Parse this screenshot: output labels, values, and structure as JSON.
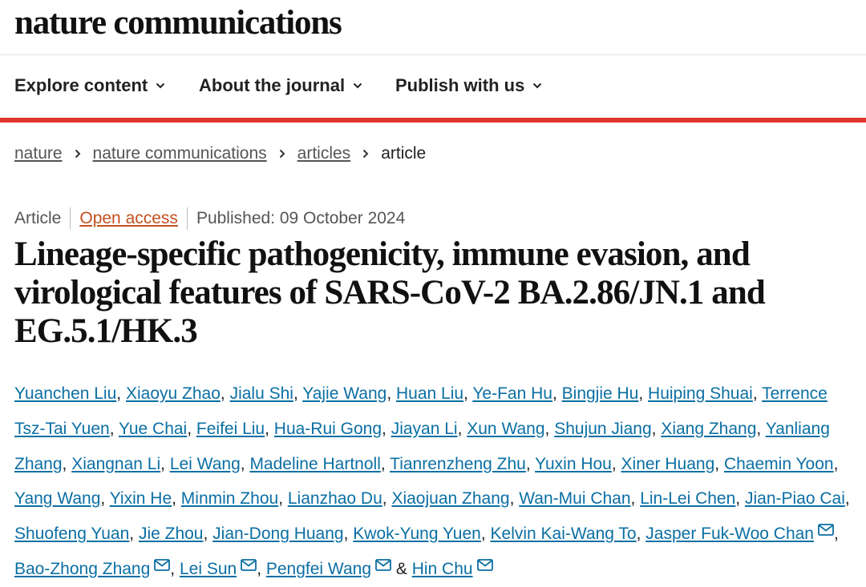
{
  "journal": {
    "name": "nature communications"
  },
  "nav": {
    "items": [
      {
        "label": "Explore content"
      },
      {
        "label": "About the journal"
      },
      {
        "label": "Publish with us"
      }
    ]
  },
  "breadcrumb": {
    "items": [
      "nature",
      "nature communications",
      "articles"
    ],
    "current": "article"
  },
  "article": {
    "type": "Article",
    "access": "Open access",
    "published": "Published: 09 October 2024",
    "title": "Lineage-specific pathogenicity, immune evasion, and virological features of SARS-CoV-2 BA.2.86/JN.1 and EG.5.1/HK.3",
    "authors": [
      {
        "name": "Yuanchen Liu",
        "email": false
      },
      {
        "name": "Xiaoyu Zhao",
        "email": false
      },
      {
        "name": "Jialu Shi",
        "email": false
      },
      {
        "name": "Yajie Wang",
        "email": false
      },
      {
        "name": "Huan Liu",
        "email": false
      },
      {
        "name": "Ye-Fan Hu",
        "email": false
      },
      {
        "name": "Bingjie Hu",
        "email": false
      },
      {
        "name": "Huiping Shuai",
        "email": false
      },
      {
        "name": "Terrence Tsz-Tai Yuen",
        "email": false
      },
      {
        "name": "Yue Chai",
        "email": false
      },
      {
        "name": "Feifei Liu",
        "email": false
      },
      {
        "name": "Hua-Rui Gong",
        "email": false
      },
      {
        "name": "Jiayan Li",
        "email": false
      },
      {
        "name": "Xun Wang",
        "email": false
      },
      {
        "name": "Shujun Jiang",
        "email": false
      },
      {
        "name": "Xiang Zhang",
        "email": false
      },
      {
        "name": "Yanliang Zhang",
        "email": false
      },
      {
        "name": "Xiangnan Li",
        "email": false
      },
      {
        "name": "Lei Wang",
        "email": false
      },
      {
        "name": "Madeline Hartnoll",
        "email": false
      },
      {
        "name": "Tianrenzheng Zhu",
        "email": false
      },
      {
        "name": "Yuxin Hou",
        "email": false
      },
      {
        "name": "Xiner Huang",
        "email": false
      },
      {
        "name": "Chaemin Yoon",
        "email": false
      },
      {
        "name": "Yang Wang",
        "email": false
      },
      {
        "name": "Yixin He",
        "email": false
      },
      {
        "name": "Minmin Zhou",
        "email": false
      },
      {
        "name": "Lianzhao Du",
        "email": false
      },
      {
        "name": "Xiaojuan Zhang",
        "email": false
      },
      {
        "name": "Wan-Mui Chan",
        "email": false
      },
      {
        "name": "Lin-Lei Chen",
        "email": false
      },
      {
        "name": "Jian-Piao Cai",
        "email": false
      },
      {
        "name": "Shuofeng Yuan",
        "email": false
      },
      {
        "name": "Jie Zhou",
        "email": false
      },
      {
        "name": "Jian-Dong Huang",
        "email": false
      },
      {
        "name": "Kwok-Yung Yuen",
        "email": false
      },
      {
        "name": "Kelvin Kai-Wang To",
        "email": false
      },
      {
        "name": "Jasper Fuk-Woo Chan",
        "email": true
      },
      {
        "name": "Bao-Zhong Zhang",
        "email": true
      },
      {
        "name": "Lei Sun",
        "email": true
      },
      {
        "name": "Pengfei Wang",
        "email": true
      },
      {
        "name": "Hin Chu",
        "email": true
      }
    ]
  },
  "colors": {
    "accent_bar": "#e0372f",
    "author_link": "#0b6fa4",
    "open_access": "#c4501d"
  },
  "icons": {
    "nav_dropdown": "chevron-down-icon",
    "crumb_separator": "chevron-right-icon",
    "email": "envelope-icon"
  }
}
